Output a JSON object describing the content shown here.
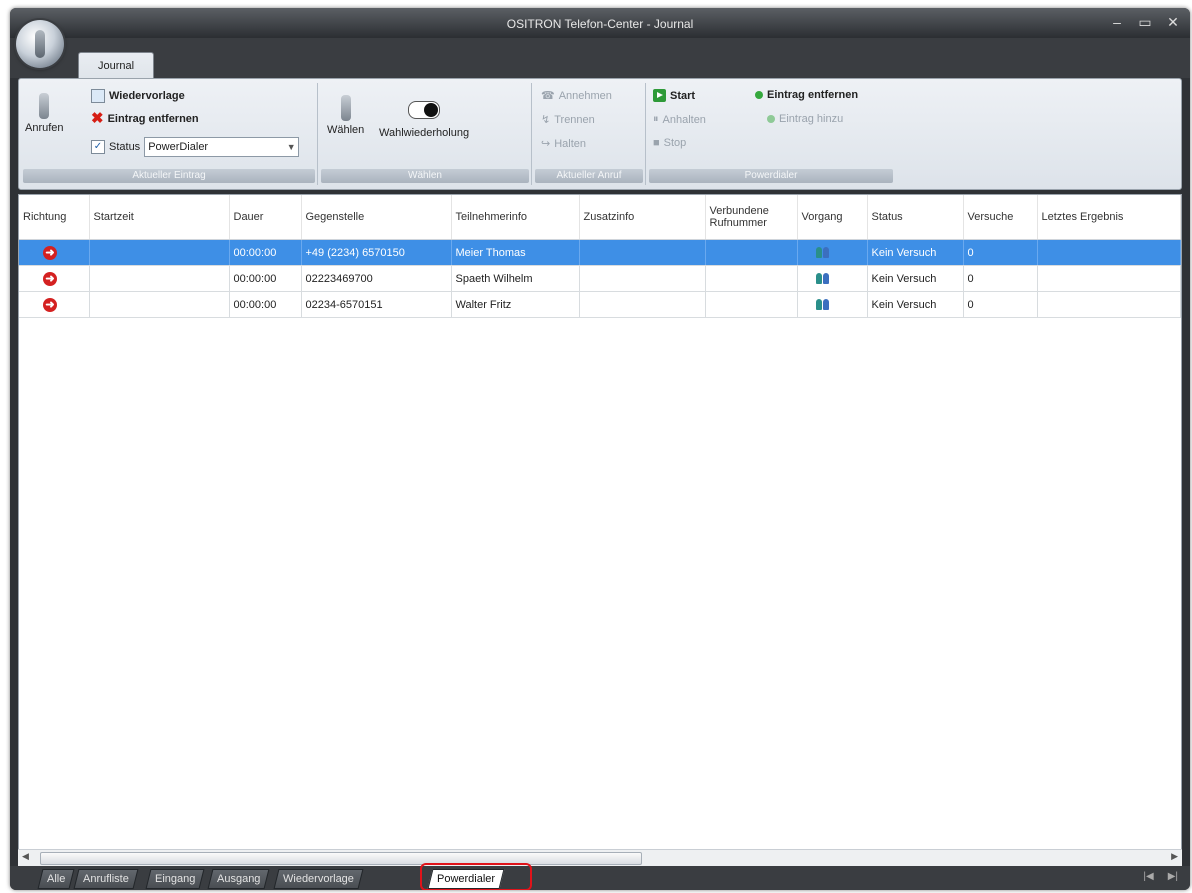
{
  "window": {
    "title": "OSITRON Telefon-Center - Journal",
    "controls": [
      "–",
      "▭",
      "✕"
    ]
  },
  "ribbon_tab": "Journal",
  "ribbon": {
    "group_aktueller_eintrag": {
      "caption": "Aktueller Eintrag",
      "anrufen": "Anrufen",
      "wiedervorlage": "Wiedervorlage",
      "eintrag_entfernen": "Eintrag entfernen",
      "status_label": "Status",
      "status_value": "PowerDialer"
    },
    "group_waehlen": {
      "caption": "Wählen",
      "waehlen": "Wählen",
      "wahlwiederholung": "Wahlwiederholung"
    },
    "group_aktueller_anruf": {
      "caption": "Aktueller Anruf",
      "annehmen": "Annehmen",
      "trennen": "Trennen",
      "halten": "Halten"
    },
    "group_powerdialer": {
      "caption": "Powerdialer",
      "start": "Start",
      "anhalten": "Anhalten",
      "stop": "Stop",
      "eintrag_entfernen": "Eintrag entfernen",
      "eintrag_hinzu": "Eintrag hinzu"
    }
  },
  "table": {
    "columns": [
      "Richtung",
      "Startzeit",
      "Dauer",
      "Gegenstelle",
      "Teilnehmerinfo",
      "Zusatzinfo",
      "Verbundene Rufnummer",
      "Vorgang",
      "Status",
      "Versuche",
      "Letztes Ergebnis"
    ],
    "rows": [
      {
        "startzeit": "",
        "dauer": "00:00:00",
        "gegenstelle": "+49 (2234) 6570150",
        "teilnehmer": "Meier Thomas",
        "zusatz": "",
        "verbunden": "",
        "status": "Kein Versuch",
        "versuche": "0",
        "ergebnis": ""
      },
      {
        "startzeit": "",
        "dauer": "00:00:00",
        "gegenstelle": "02223469700",
        "teilnehmer": "Spaeth Wilhelm",
        "zusatz": "",
        "verbunden": "",
        "status": "Kein Versuch",
        "versuche": "0",
        "ergebnis": ""
      },
      {
        "startzeit": "",
        "dauer": "00:00:00",
        "gegenstelle": "02234-6570151",
        "teilnehmer": "Walter Fritz",
        "zusatz": "",
        "verbunden": "",
        "status": "Kein Versuch",
        "versuche": "0",
        "ergebnis": ""
      }
    ]
  },
  "sheet_tabs": [
    "Alle",
    "Anrufliste",
    "Eingang",
    "Ausgang",
    "Wiedervorlage",
    "Powerdialer"
  ],
  "active_sheet_tab": "Powerdialer",
  "colors": {
    "selection": "#3e8fe6",
    "highlight_box": "#e0131a"
  }
}
